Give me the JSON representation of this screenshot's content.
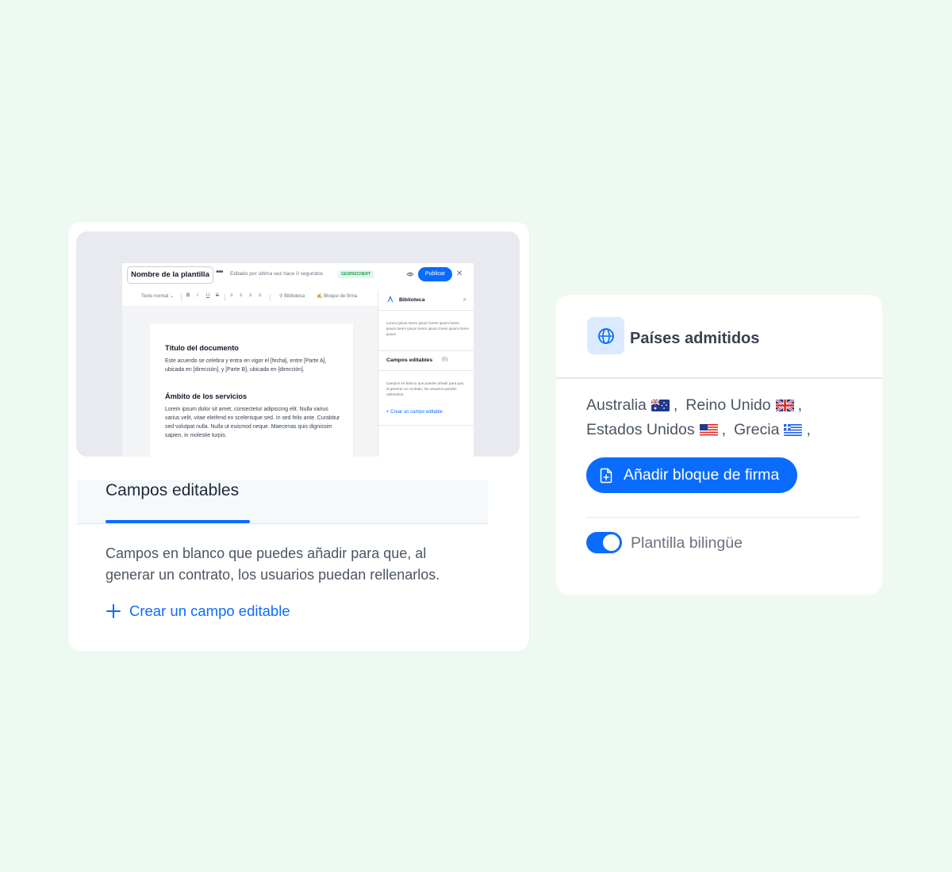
{
  "editor": {
    "template_name": "Nombre de la plantilla",
    "edited_text": "Editado por última vez hace 0 segundos",
    "saved_badge": "GESPEICHERT",
    "publish_label": "Publicar",
    "toolbar": {
      "text_style": "Texto normal",
      "bold": "B",
      "italic": "I",
      "underline": "U",
      "strike": "S",
      "library": "Biblioteca",
      "signature_block": "Bloque de firma"
    },
    "document": {
      "title": "Título del documento",
      "intro": "Este acuerdo se celebra y entra en vigor el [fecha], entre [Parte A], ubicada en [dirección], y [Parte B], ubicada en [dirección].",
      "section_title": "Ámbito de los servicios",
      "section_body": "Lorem ipsum dolor sit amet, consectetur adipiscing elit. Nulla varius varius velit, vitae eleifend ex scelerisque sed. In sed felis ante. Curabitur sed volutpat nulla. Nulla ut euismod neque. Maecenas quis dignissim sapien, in molestie turpis."
    },
    "sidebar": {
      "title": "Biblioteca",
      "lorem": "Lorem ipsum lorem ipsum lorem ipsum lorem ipsum lorem ipsum lorem ipsum lorem ipsum lorem ipsum",
      "fields_title": "Campos editables",
      "fields_count": "(0)",
      "fields_desc": "Campos en blanco que puedes añadir para que, al generar un contrato, los usuarios puedan rellenarlos.",
      "create_link": "Crear un campo editable"
    }
  },
  "left_card": {
    "tab_label": "Campos editables",
    "description": "Campos en blanco que puedes añadir para que, al generar un contrato, los usuarios puedan rellenarlos.",
    "create_link": "Crear un campo editable"
  },
  "right_card": {
    "title": "Países admitidos",
    "countries": [
      {
        "name": "Australia",
        "flag": "australia-flag-icon"
      },
      {
        "name": "Reino Unido",
        "flag": "uk-flag-icon"
      },
      {
        "name": "Estados Unidos",
        "flag": "us-flag-icon"
      },
      {
        "name": "Grecia",
        "flag": "greece-flag-icon"
      }
    ],
    "separator": ",",
    "sign_button": "Añadir bloque de firma",
    "bilingual_label": "Plantilla bilingüe",
    "bilingual_enabled": true
  },
  "colors": {
    "background": "#eef9f2",
    "accent": "#0a6cff",
    "saved_badge_bg": "#e3f6e9",
    "saved_badge_text": "#1f9d55",
    "icon_box_bg": "#dbeafe"
  }
}
